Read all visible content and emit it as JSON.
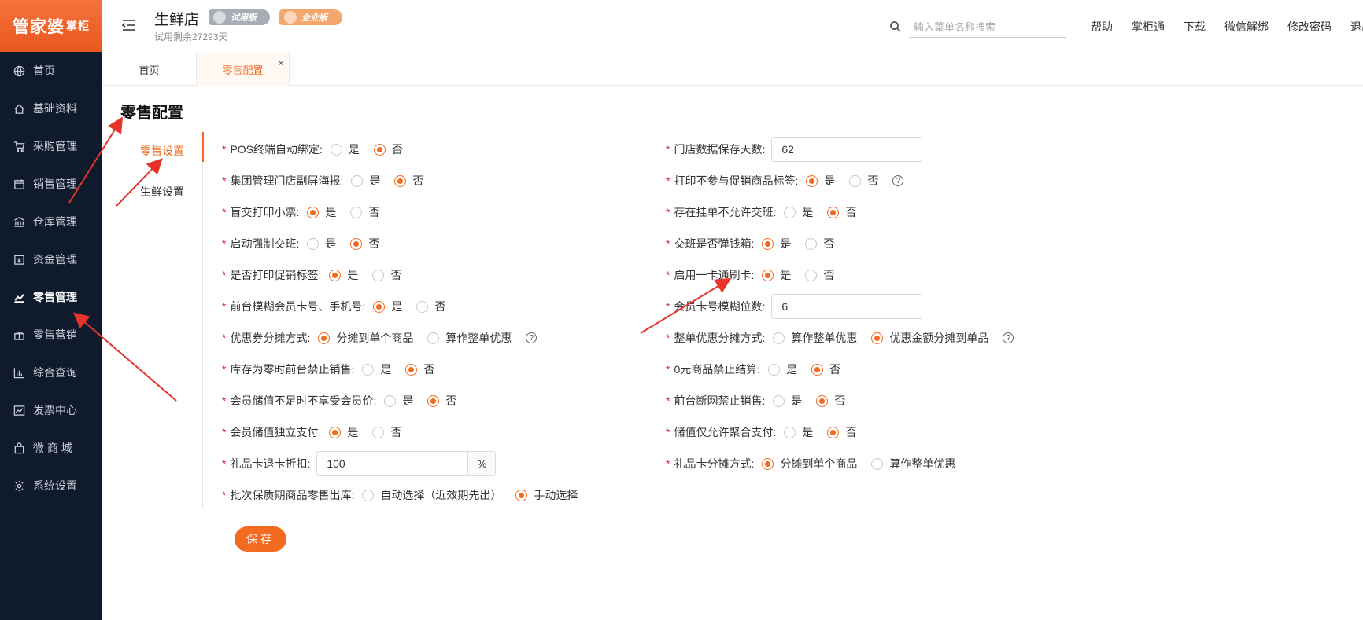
{
  "logo": {
    "brand": "管家婆",
    "product": "掌柜"
  },
  "sidebar": {
    "items": [
      {
        "label": "首页",
        "icon": "globe-icon"
      },
      {
        "label": "基础资料",
        "icon": "home-icon"
      },
      {
        "label": "采购管理",
        "icon": "cart-icon"
      },
      {
        "label": "销售管理",
        "icon": "calendar-icon"
      },
      {
        "label": "仓库管理",
        "icon": "bank-icon"
      },
      {
        "label": "资金管理",
        "icon": "wallet-icon"
      },
      {
        "label": "零售管理",
        "icon": "chart-icon",
        "active": true
      },
      {
        "label": "零售营销",
        "icon": "gift-icon"
      },
      {
        "label": "综合查询",
        "icon": "bar-chart-icon"
      },
      {
        "label": "发票中心",
        "icon": "trend-icon"
      },
      {
        "label": "微 商 城",
        "icon": "bag-icon"
      },
      {
        "label": "系统设置",
        "icon": "gear-icon"
      }
    ]
  },
  "header": {
    "store_name": "生鲜店",
    "trial_info": "试用剩余27293天",
    "badge_trial": "试用版",
    "badge_enterprise": "企业版",
    "search_placeholder": "输入菜单名称搜索",
    "links": [
      "帮助",
      "掌柜通",
      "下载",
      "微信解绑",
      "修改密码",
      "退出"
    ]
  },
  "tabs": [
    {
      "label": "首页"
    },
    {
      "label": "零售配置",
      "active": true,
      "close": "×"
    }
  ],
  "page": {
    "title": "零售配置",
    "sub_nav": [
      {
        "label": "零售设置",
        "active": true
      },
      {
        "label": "生鲜设置"
      }
    ],
    "save_label": "保存"
  },
  "form": {
    "left": [
      {
        "label": "POS终端自动绑定:",
        "type": "radio",
        "options": [
          "是",
          "否"
        ],
        "selected": 1
      },
      {
        "label": "集团管理门店副屏海报:",
        "type": "radio",
        "options": [
          "是",
          "否"
        ],
        "selected": 1
      },
      {
        "label": "盲交打印小票:",
        "type": "radio",
        "options": [
          "是",
          "否"
        ],
        "selected": 0
      },
      {
        "label": "启动强制交班:",
        "type": "radio",
        "options": [
          "是",
          "否"
        ],
        "selected": 1
      },
      {
        "label": "是否打印促销标签:",
        "type": "radio",
        "options": [
          "是",
          "否"
        ],
        "selected": 0
      },
      {
        "label": "前台模糊会员卡号、手机号:",
        "type": "radio",
        "options": [
          "是",
          "否"
        ],
        "selected": 0
      },
      {
        "label": "优惠券分摊方式:",
        "type": "radio",
        "options": [
          "分摊到单个商品",
          "算作整单优惠"
        ],
        "selected": 0,
        "help": "?"
      },
      {
        "label": "库存为零时前台禁止销售:",
        "type": "radio",
        "options": [
          "是",
          "否"
        ],
        "selected": 1
      },
      {
        "label": "会员储值不足时不享受会员价:",
        "type": "radio",
        "options": [
          "是",
          "否"
        ],
        "selected": 1
      },
      {
        "label": "会员储值独立支付:",
        "type": "radio",
        "options": [
          "是",
          "否"
        ],
        "selected": 0
      },
      {
        "label": "礼品卡退卡折扣:",
        "type": "input-suffix",
        "value": "100",
        "suffix": "%"
      },
      {
        "label": "批次保质期商品零售出库:",
        "type": "radio",
        "options": [
          "自动选择（近效期先出）",
          "手动选择"
        ],
        "selected": 1
      }
    ],
    "right": [
      {
        "label": "门店数据保存天数:",
        "type": "input",
        "value": "62"
      },
      {
        "label": "打印不参与促销商品标签:",
        "type": "radio",
        "options": [
          "是",
          "否"
        ],
        "selected": 0,
        "help": "?"
      },
      {
        "label": "存在挂单不允许交班:",
        "type": "radio",
        "options": [
          "是",
          "否"
        ],
        "selected": 1
      },
      {
        "label": "交班是否弹钱箱:",
        "type": "radio",
        "options": [
          "是",
          "否"
        ],
        "selected": 0
      },
      {
        "label": "启用一卡通刷卡:",
        "type": "radio",
        "options": [
          "是",
          "否"
        ],
        "selected": 0
      },
      {
        "label": "会员卡号模糊位数:",
        "type": "input",
        "value": "6"
      },
      {
        "label": "整单优惠分摊方式:",
        "type": "radio",
        "options": [
          "算作整单优惠",
          "优惠金额分摊到单品"
        ],
        "selected": 1,
        "help": "?"
      },
      {
        "label": "0元商品禁止结算:",
        "type": "radio",
        "options": [
          "是",
          "否"
        ],
        "selected": 1
      },
      {
        "label": "前台断网禁止销售:",
        "type": "radio",
        "options": [
          "是",
          "否"
        ],
        "selected": 1
      },
      {
        "label": "储值仅允许聚合支付:",
        "type": "radio",
        "options": [
          "是",
          "否"
        ],
        "selected": 1
      },
      {
        "label": "礼品卡分摊方式:",
        "type": "radio",
        "options": [
          "分摊到单个商品",
          "算作整单优惠"
        ],
        "selected": 0
      }
    ]
  },
  "colors": {
    "accent": "#f26b21",
    "sidebar_bg": "#0f1b2d",
    "annotation": "#e8332a"
  }
}
